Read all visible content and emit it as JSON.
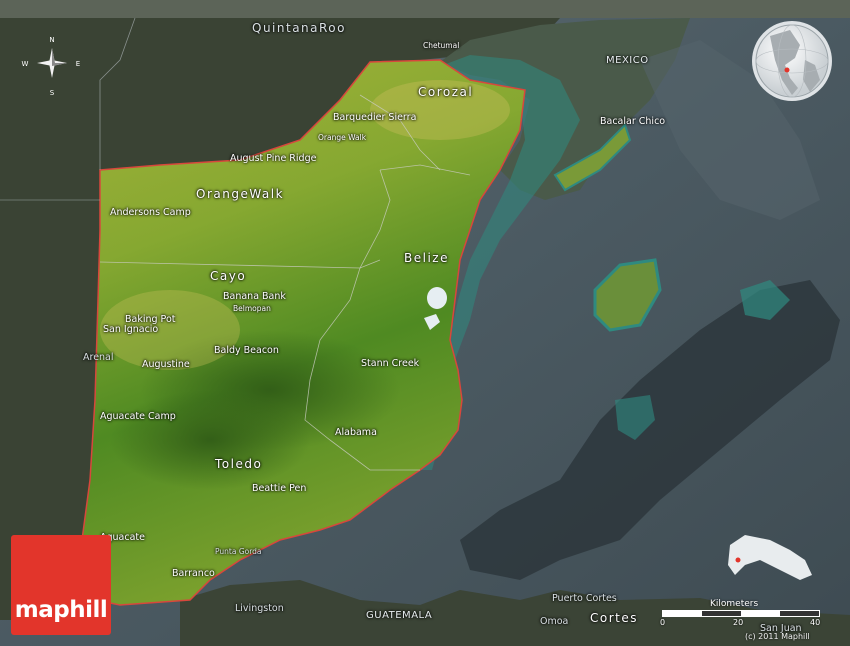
{
  "labels": {
    "quintana_roo": "QuintanaRoo",
    "chetumal": "Chetumal",
    "mexico": "MEXICO",
    "corozal": "Corozal",
    "barquedier_sierra": "Barquedier Sierra",
    "orange_walk_town": "Orange Walk",
    "bacalar_chico": "Bacalar Chico",
    "august_pine_ridge": "August Pine Ridge",
    "orange_walk_district": "OrangeWalk",
    "andersons_camp": "Andersons Camp",
    "belize": "Belize",
    "cayo": "Cayo",
    "banana_bank": "Banana Bank",
    "belmopan": "Belmopan",
    "baking_pot": "Baking Pot",
    "san_ignacio": "San Ignacio",
    "arenal": "Arenal",
    "baldy_beacon": "Baldy Beacon",
    "augustine": "Augustine",
    "stann_creek": "Stann Creek",
    "aguacate_camp": "Aguacate Camp",
    "alabama": "Alabama",
    "toledo": "Toledo",
    "beattie_pen": "Beattie Pen",
    "aguacate": "Aguacate",
    "punta_gorda": "Punta Gorda",
    "barranco": "Barranco",
    "livingston": "Livingston",
    "guatemala": "GUATEMALA",
    "puerto_cortes": "Puerto Cortes",
    "omoa": "Omoa",
    "cortes": "Cortes",
    "san_juan": "San Juan"
  },
  "compass": {
    "n": "N",
    "s": "S",
    "e": "E",
    "w": "W"
  },
  "logo": "maphill",
  "scale": {
    "title": "Kilometers",
    "ticks": [
      "0",
      "20",
      "40"
    ]
  },
  "copyright": "(c) 2011 Maphill",
  "colors": {
    "land_green": "#6f9a2a",
    "land_yellow": "#a9b33c",
    "neighbor_land": "#3d4538",
    "sea": "#4b5a62",
    "shallow_water": "#2f8a80",
    "border": "#d8473c",
    "logo_red": "#e2352b"
  }
}
